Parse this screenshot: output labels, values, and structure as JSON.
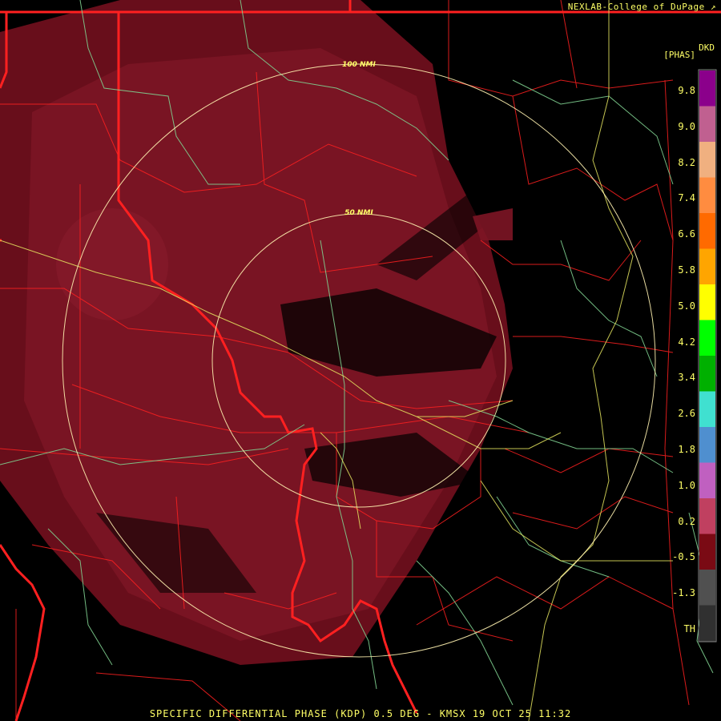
{
  "credit": "NEXLAB-College of DuPage",
  "credit_icon": "external-link-icon",
  "caption": "SPECIFIC DIFFERENTIAL PHASE (KDP) 0.5 DEG - KMSX 19 OCT 25 11:32",
  "ring_labels": {
    "inner": "50 NMI",
    "outer": "100 NMI"
  },
  "legend": {
    "unit_top": "DKD",
    "unit_bottom": "[PHAS]",
    "labels": [
      "9.8",
      "9.0",
      "8.2",
      "7.4",
      "6.6",
      "5.8",
      "5.0",
      "4.2",
      "3.4",
      "2.6",
      "1.8",
      "1.0",
      "0.2",
      "-0.5",
      "-1.3",
      "TH"
    ],
    "colors": [
      "#8b008b",
      "#c06090",
      "#f0b080",
      "#ff8c40",
      "#ff6a00",
      "#ffa500",
      "#ffff00",
      "#00ff00",
      "#00b000",
      "#40e0d0",
      "#4f8fcf",
      "#c060c0",
      "#c04060",
      "#7a0a14",
      "#505050",
      "#303030"
    ]
  },
  "colors": {
    "echo": "#7a1020",
    "county_lines": "#ff2020",
    "state_lines": "#ff2020",
    "rivers": "#7fd090",
    "highways": "#e6e660",
    "range_rings": "#fff2b0"
  }
}
